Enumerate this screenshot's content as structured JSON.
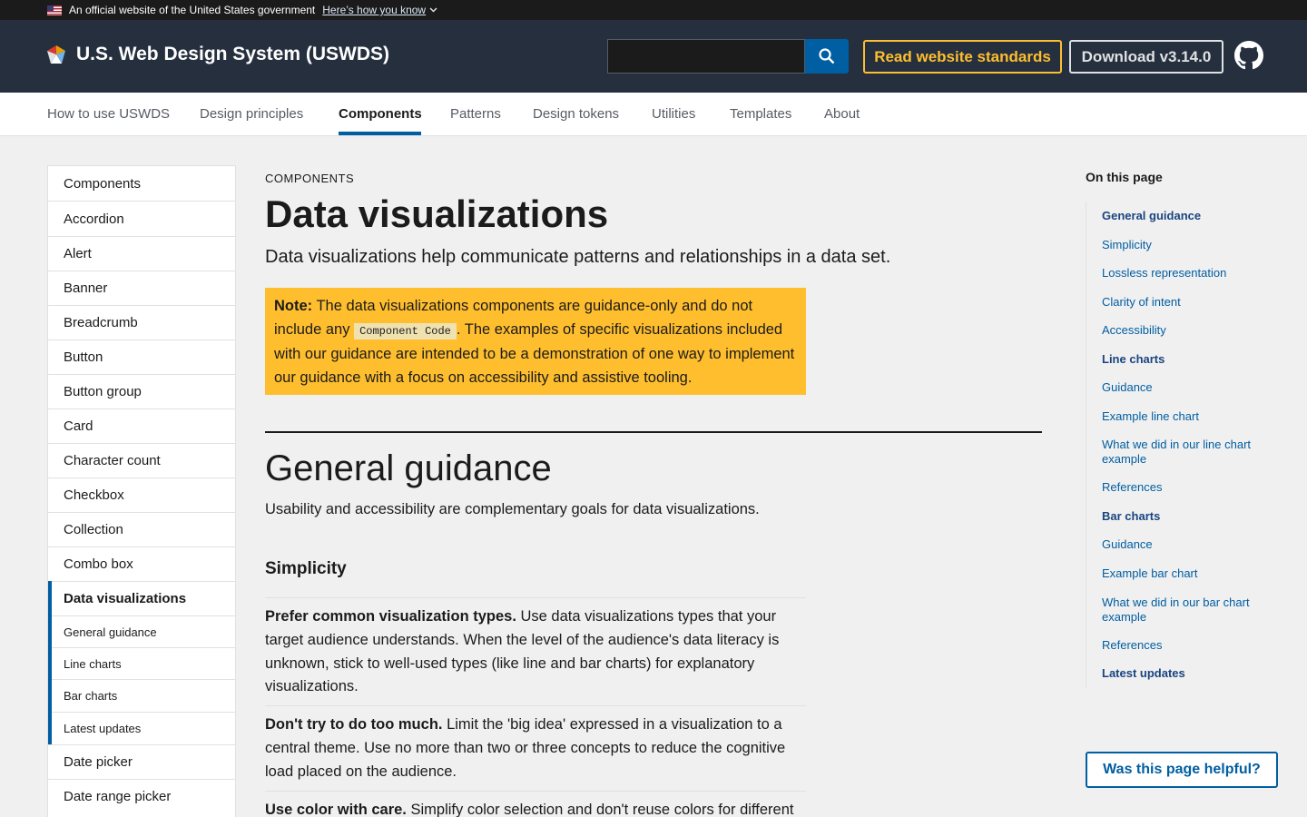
{
  "banner": {
    "text": "An official website of the United States government",
    "link": "Here’s how you know"
  },
  "header": {
    "logo_text": "U.S. Web Design System (USWDS)",
    "search_placeholder": "",
    "standards_button": "Read website standards",
    "download_button": "Download v3.14.0"
  },
  "nav": {
    "items": [
      "How to use USWDS",
      "Design principles",
      "Components",
      "Patterns",
      "Design tokens",
      "Utilities",
      "Templates",
      "About"
    ],
    "active": "Components"
  },
  "sidenav": {
    "items": [
      "Components",
      "Accordion",
      "Alert",
      "Banner",
      "Breadcrumb",
      "Button",
      "Button group",
      "Card",
      "Character count",
      "Checkbox",
      "Collection",
      "Combo box",
      "Data visualizations",
      "General guidance",
      "Line charts",
      "Bar charts",
      "Latest updates",
      "Date picker",
      "Date range picker"
    ],
    "current": "Data visualizations"
  },
  "main": {
    "eyebrow": "COMPONENTS",
    "title": "Data visualizations",
    "lead": "Data visualizations help communicate patterns and relationships in a data set.",
    "note": {
      "label": "Note:",
      "text_before": " The data visualizations components are guidance-only and do not include any ",
      "code": "Component Code",
      "text_after": ". The examples of specific visualizations included with our guidance are intended to be a demonstration of one way to implement our guidance with a focus on accessibility and assistive tooling."
    },
    "section_title": "General guidance",
    "section_intro": "Usability and accessibility are complementary goals for data visualizations.",
    "subsection_title": "Simplicity",
    "paragraphs": [
      {
        "bold": "Prefer common visualization types.",
        "text": " Use data visualizations types that your target audience understands. When the level of the audience's data literacy is unknown, stick to well-used types (like line and bar charts) for explanatory visualizations."
      },
      {
        "bold": "Don't try to do too much.",
        "text": " Limit the 'big idea' expressed in a visualization to a central theme. Use no more than two or three concepts to reduce the cognitive load placed on the audience."
      },
      {
        "bold": "Use color with care.",
        "text": " Simplify color selection and don't reuse colors for different"
      }
    ]
  },
  "on_this_page": {
    "title": "On this page",
    "links": [
      "General guidance",
      "Simplicity",
      "Lossless representation",
      "Clarity of intent",
      "Accessibility",
      "Line charts",
      "Guidance",
      "Example line chart",
      "What we did in our line chart example",
      "References",
      "Bar charts",
      "Guidance",
      "Example bar chart",
      "What we did in our bar chart example",
      "References",
      "Latest updates"
    ]
  },
  "helpful_button": "Was this page helpful?",
  "colors": {
    "header_bg": "#252f3e",
    "primary": "#005ea2",
    "gold": "#ffbe2e"
  }
}
